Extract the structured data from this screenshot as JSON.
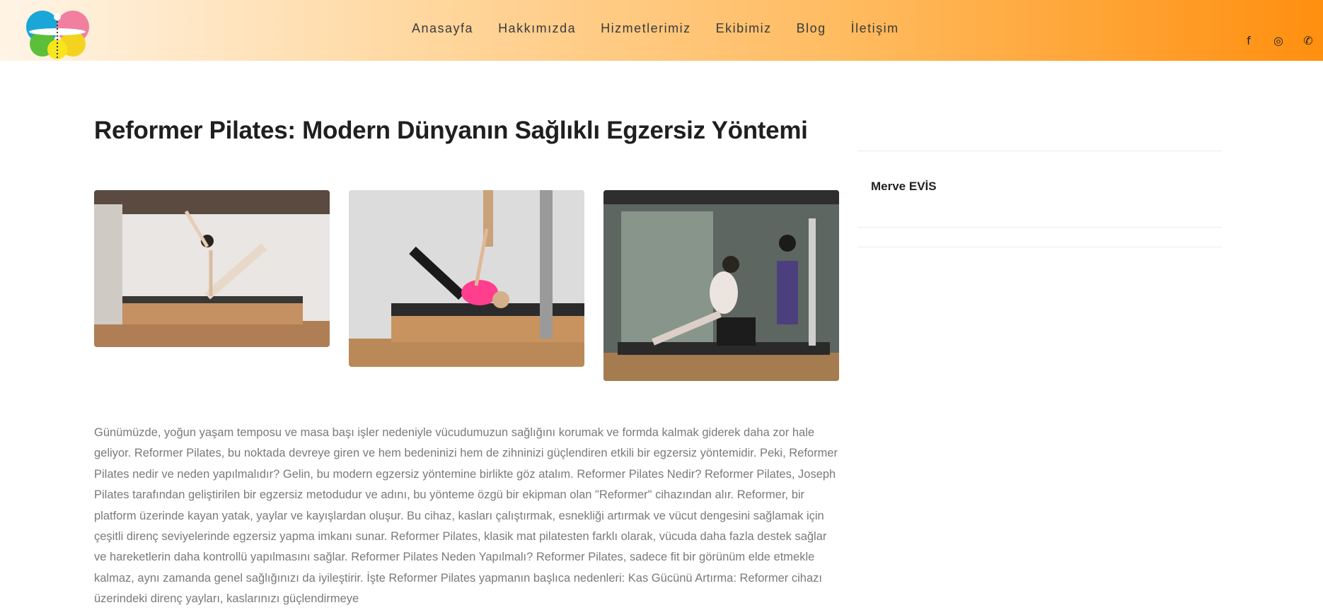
{
  "nav": {
    "items": [
      "Anasayfa",
      "Hakkımızda",
      "Hizmetlerimiz",
      "Ekibimiz",
      "Blog",
      "İletişim"
    ]
  },
  "social": {
    "icons": [
      "facebook-icon",
      "instagram-icon",
      "whatsapp-icon"
    ],
    "glyphs": [
      "f",
      "◎",
      "✆"
    ]
  },
  "colors": {
    "header_start": "#fff4e6",
    "header_end": "#ff8f0f",
    "title": "#1f1f1f",
    "body_text": "#7a7a7a"
  },
  "post": {
    "title": "Reformer Pilates: Modern Dünyanın Sağlıklı Egzersiz Yöntemi",
    "body": "Günümüzde, yoğun yaşam temposu ve masa başı işler nedeniyle vücudumuzun sağlığını korumak ve formda kalmak giderek daha zor hale geliyor. Reformer Pilates, bu noktada devreye giren ve hem bedeninizi hem de zihninizi güçlendiren etkili bir egzersiz yöntemidir. Peki, Reformer Pilates nedir ve neden yapılmalıdır? Gelin, bu modern egzersiz yöntemine birlikte göz atalım. Reformer Pilates Nedir? Reformer Pilates, Joseph Pilates tarafından geliştirilen bir egzersiz metodudur ve adını, bu yönteme özgü bir ekipman olan \"Reformer\" cihazından alır. Reformer, bir platform üzerinde kayan yatak, yaylar ve kayışlardan oluşur. Bu cihaz, kasları çalıştırmak, esnekliği artırmak ve vücut dengesini sağlamak için çeşitli direnç seviyelerinde egzersiz yapma imkanı sunar. Reformer Pilates, klasik mat pilatesten farklı olarak, vücuda daha fazla destek sağlar ve hareketlerin daha kontrollü yapılmasını sağlar. Reformer Pilates Neden Yapılmalı? Reformer Pilates, sadece fit bir görünüm elde etmekle kalmaz, aynı zamanda genel sağlığınızı da iyileştirir. İşte Reformer Pilates yapmanın başlıca nedenleri: Kas Gücünü Artırma: Reformer cihazı üzerindeki direnç yayları, kaslarınızı güçlendirmeye"
  },
  "sidebar": {
    "author": "Merve EVİS"
  }
}
